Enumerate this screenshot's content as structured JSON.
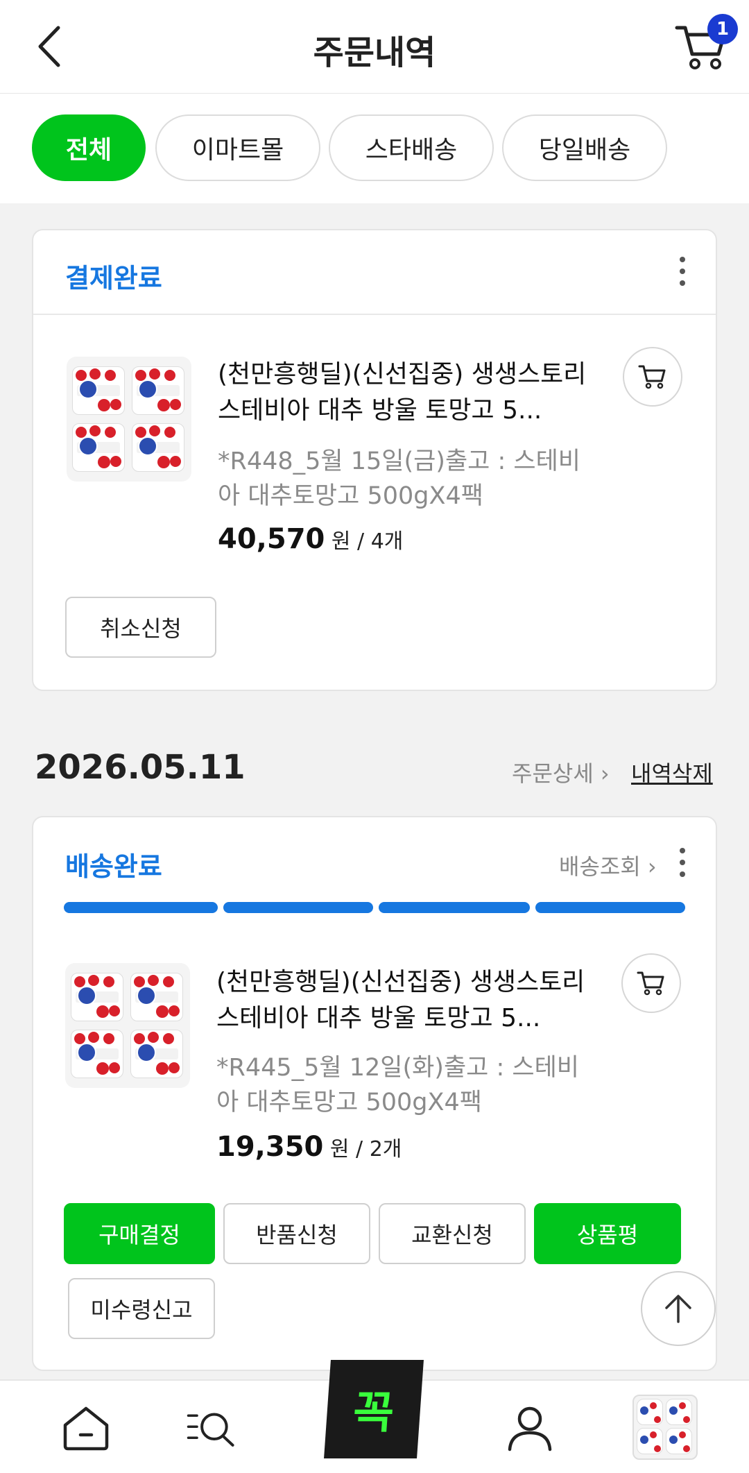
{
  "header": {
    "title": "주문내역",
    "cart_count": "1"
  },
  "tabs": [
    {
      "label": "전체",
      "active": true
    },
    {
      "label": "이마트몰",
      "active": false
    },
    {
      "label": "스타배송",
      "active": false
    },
    {
      "label": "당일배송",
      "active": false
    }
  ],
  "orders": [
    {
      "status": "결제완료",
      "product_name": "(천만흥행딜)(신선집중) 생생스토리 스테비아 대추 방울 토망고 5...",
      "option": "*R448_5월 15일(금)출고 : 스테비아 대추토망고 500gX4팩",
      "price": "40,570",
      "price_unit": "원",
      "qty": " / 4개",
      "buttons": [
        "취소신청"
      ]
    },
    {
      "date": "2026.05.11",
      "detail_link": "주문상세 ›",
      "delete_link": "내역삭제",
      "status": "배송완료",
      "tracking_link": "배송조회 ›",
      "delivery_progress": 1.0,
      "product_name": "(천만흥행딜)(신선집중) 생생스토리 스테비아 대추 방울 토망고 5...",
      "option": "*R445_5월 12일(화)출고 : 스테비아 대추토망고 500gX4팩",
      "price": "19,350",
      "price_unit": "원",
      "qty": " / 2개",
      "buttons": [
        "구매결정",
        "반품신청",
        "교환신청",
        "상품평",
        "미수령신고"
      ]
    }
  ],
  "bottom_nav": {
    "items": [
      "home-icon",
      "category-search-icon",
      "kkok-logo",
      "my-page-icon",
      "recent-product-thumbnail"
    ],
    "center_logo": "꼭"
  },
  "colors": {
    "accent_green": "#00c41c",
    "status_blue": "#1677e0",
    "badge_blue": "#1a3bd1"
  }
}
